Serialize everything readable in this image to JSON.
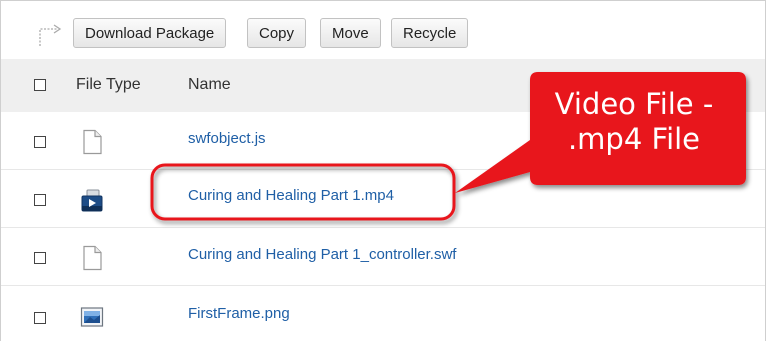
{
  "toolbar": {
    "buttons": [
      {
        "label": "Download Package"
      },
      {
        "label": "Copy"
      },
      {
        "label": "Move"
      },
      {
        "label": "Recycle"
      }
    ]
  },
  "table": {
    "columns": {
      "file_type": "File Type",
      "name": "Name"
    },
    "rows": [
      {
        "name": "swfobject.js",
        "icon": "document-icon"
      },
      {
        "name": "Curing and Healing Part 1.mp4",
        "icon": "video-file-icon"
      },
      {
        "name": "Curing and Healing Part 1_controller.swf",
        "icon": "document-icon"
      },
      {
        "name": "FirstFrame.png",
        "icon": "image-file-icon"
      }
    ]
  },
  "annotation": {
    "line1": "Video File -",
    "line2": ".mp4 File",
    "color": "#e8141c"
  }
}
